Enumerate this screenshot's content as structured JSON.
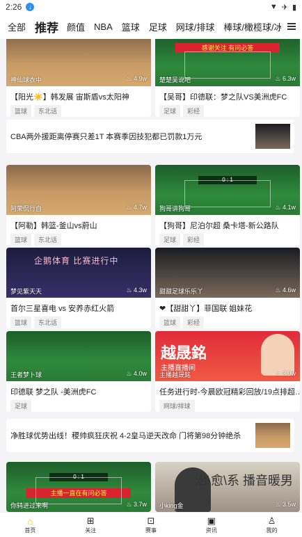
{
  "status_bar": {
    "time": "2:26"
  },
  "tabs": [
    "全部",
    "推荐",
    "颜值",
    "NBA",
    "篮球",
    "足球",
    "网球/排球",
    "棒球/橄榄球/冰球"
  ],
  "cards": [
    {
      "channel": "神仙球衣中",
      "views": "4.9w",
      "title": "【阳光☀️】韩发展 宙斯盾vs太阳神",
      "tags": [
        "篮球",
        "东北话"
      ]
    },
    {
      "channel": "楚楚吴说吧",
      "views": "6.3w",
      "title": "【吴哥】印德联：梦之队VS美洲虎FC",
      "tags": [
        "足球",
        "彩经"
      ],
      "banner": "感谢关注 有问必答"
    },
    {
      "channel": "阿荣侃行自",
      "views": "4.7w",
      "title": "【阿勒】韩篮-釜山vs蔚山",
      "tags": [
        "篮球",
        "东北话"
      ]
    },
    {
      "channel": "狗哥讲狗哥",
      "views": "4.1w",
      "title": "【狗哥】尼泊尔超 桑卡塔-新公路队",
      "tags": [
        "足球",
        "彩经"
      ],
      "score": "0 : 1"
    },
    {
      "channel": "梦见紫天天",
      "views": "4.3w",
      "title": "首尔三星喜电 vs 安养赤红火箭",
      "tags": [
        "篮球",
        "东北话"
      ],
      "stream_title": "企鹅体育 比赛进行中"
    },
    {
      "channel": "甜甜足球乐乐丫",
      "views": "4.6w",
      "title": "❤【甜甜丫】菲国联 姐妹花",
      "tags": [
        "篮球",
        "彩经"
      ]
    },
    {
      "channel": "王者梦卜球",
      "views": "4.0w",
      "title": "印德联 梦之队 -美洲虎FC",
      "tags": [
        "足球"
      ]
    },
    {
      "channel": "主播越晟銘",
      "views": "3.9w",
      "title": "任务进行时-今晨欧冠精彩回放/19点排超…",
      "tags": [
        "网球/排球"
      ],
      "promo_title": "越晟銘",
      "promo_sub": "主播直播间"
    },
    {
      "channel": "你鸫进过来啊",
      "views": "3.7w",
      "banner": "主播一直在有问必答",
      "score": "0 : 1"
    },
    {
      "channel": "小king金",
      "views": "3.5w",
      "grey_text": "治\\愈\\系 播音暖男"
    }
  ],
  "news": [
    {
      "text": "CBA两外援距离停赛只差1T 本赛季因技犯都已罚款1万元"
    },
    {
      "text": "净胜球优势出线！稷帅疯狂庆祝 4-2皇马逆天改命 门将第98分钟绝杀"
    }
  ],
  "bottom_nav": [
    {
      "label": "首页",
      "icon": "home-icon"
    },
    {
      "label": "关注",
      "icon": "plus-square-icon"
    },
    {
      "label": "赛事",
      "icon": "match-icon"
    },
    {
      "label": "资讯",
      "icon": "news-icon"
    },
    {
      "label": "我的",
      "icon": "user-icon"
    }
  ],
  "colors": {
    "accent": "#f5c400",
    "background": "#f4f4f6"
  }
}
